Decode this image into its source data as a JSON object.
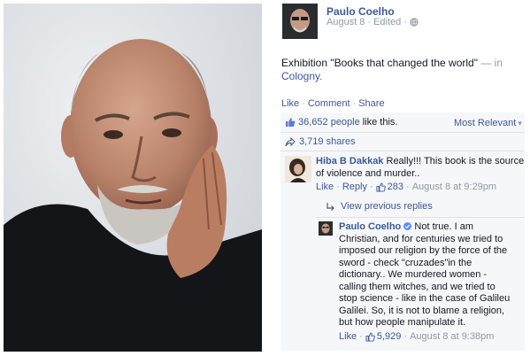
{
  "post": {
    "author": "Paulo Coelho",
    "date": "August 8",
    "sep": "·",
    "edited": "Edited",
    "text_main": "Exhibition \"Books that changed the world\"",
    "text_dash": "— in",
    "location": "Cologny.",
    "actions": [
      "Like",
      "Comment",
      "Share"
    ],
    "likes_count": "36,652 people",
    "likes_suffix": "like this.",
    "sort_label": "Most Relevant",
    "sort_arrow": "▾",
    "shares": "3,719 shares"
  },
  "comment1": {
    "author": "Hiba B Dakkak",
    "lines": [
      "Really!!! This book is the source",
      "of violence and murder.."
    ],
    "like": "Like",
    "reply": "Reply",
    "count": "283",
    "time": "August 8 at 9:29pm"
  },
  "view_previous": "View previous replies",
  "reply1": {
    "author": "Paulo Coelho",
    "first_line_rest": "Not true. I am",
    "lines": [
      "Christian, and for centuries we tried to",
      "imposed our religion by the force of the",
      "sword - check \"cruzades\"in the",
      "dictionary.. We murdered women -",
      "calling them witches, and we tried to",
      "stop science - like in the case of Galileu",
      "Galilei. So, it is not to blame a religion,",
      "but how people manipulate it."
    ],
    "like": "Like",
    "count": "5,929",
    "time": "August 8 at 9:38pm"
  },
  "colors": {
    "fb_blue": "#3b5998",
    "meta_grey": "#9197a3",
    "box_bg": "#f6f7f9"
  }
}
